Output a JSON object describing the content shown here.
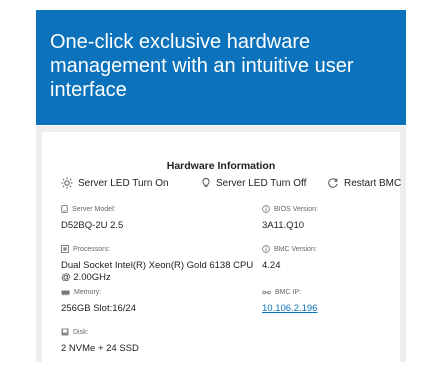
{
  "banner": {
    "line1": "One-click exclusive hardware",
    "line2": "management with an intuitive user",
    "line3": "interface"
  },
  "hardware": {
    "title": "Hardware Information",
    "actions": {
      "led_on": "Server LED Turn On",
      "led_off": "Server LED Turn Off",
      "restart": "Restart BMC"
    },
    "server_model": {
      "label": "Server Model:",
      "value": "D52BQ-2U 2.5"
    },
    "processors": {
      "label": "Processors:",
      "value_line1": "Dual Socket Intel(R) Xeon(R) Gold 6138 CPU",
      "value_line2": "@ 2.00GHz"
    },
    "memory": {
      "label": "Memory:",
      "value": "256GB Slot:16/24"
    },
    "disk": {
      "label": "Disk:",
      "value": "2 NVMe + 24 SSD"
    },
    "bios_version": {
      "label": "BIOS Version:",
      "value": "3A11.Q10"
    },
    "bmc_version": {
      "label": "BMC Version:",
      "value": "4.24"
    },
    "bmc_ip": {
      "label": "BMC IP:",
      "value": "10.106.2.196"
    }
  },
  "colors": {
    "banner": "#0b72bb",
    "link": "#0b72bb",
    "frame": "#eeeeee"
  },
  "icons": [
    "sun-icon",
    "bulb-icon",
    "restart-icon",
    "server-icon",
    "processor-icon",
    "memory-icon",
    "disk-icon",
    "info-icon",
    "network-icon"
  ]
}
